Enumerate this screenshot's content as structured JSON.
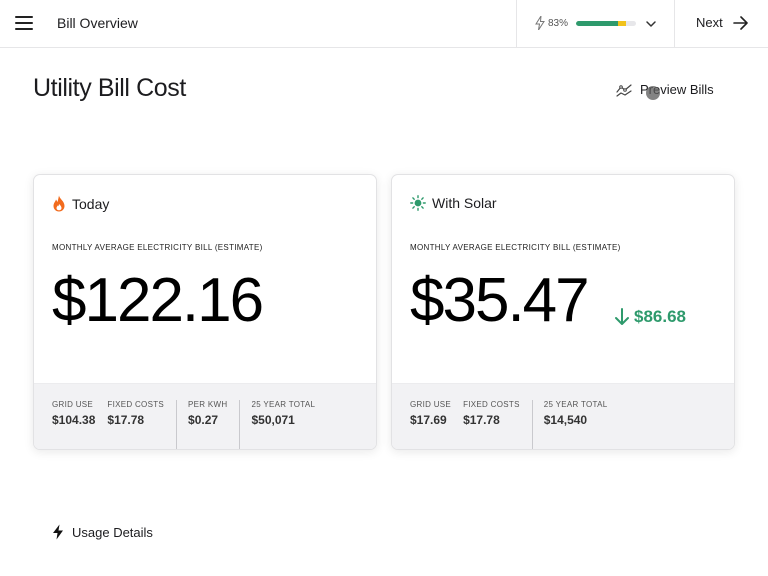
{
  "header": {
    "title": "Bill Overview",
    "progress_text": "83%",
    "progress_value": 0.83,
    "next_label": "Next"
  },
  "page": {
    "title": "Utility Bill Cost",
    "preview_label": "Preview Bills"
  },
  "cards": {
    "today": {
      "title": "Today",
      "subtitle": "MONTHLY AVERAGE ELECTRICITY BILL (ESTIMATE)",
      "amount": "$122.16",
      "stats": [
        {
          "label": "GRID USE",
          "value": "$104.38"
        },
        {
          "label": "FIXED COSTS",
          "value": "$17.78"
        },
        {
          "label": "PER KWH",
          "value": "$0.27"
        },
        {
          "label": "25 YEAR TOTAL",
          "value": "$50,071"
        }
      ]
    },
    "solar": {
      "title": "With Solar",
      "subtitle": "MONTHLY AVERAGE ELECTRICITY BILL (ESTIMATE)",
      "amount": "$35.47",
      "savings": "$86.68",
      "stats": [
        {
          "label": "GRID USE",
          "value": "$17.69"
        },
        {
          "label": "FIXED COSTS",
          "value": "$17.78"
        },
        {
          "label": "25 YEAR TOTAL",
          "value": "$14,540"
        }
      ]
    }
  },
  "usage": {
    "label": "Usage Details"
  },
  "colors": {
    "accent_green": "#2e9a6c",
    "flame_orange": "#f26b1d",
    "warning_yellow": "#f1c21b"
  },
  "icons": [
    "menu-icon",
    "bolt-icon",
    "chevron-down-icon",
    "arrow-right-icon",
    "chart-icon",
    "flame-icon",
    "sun-icon",
    "arrow-down-icon"
  ]
}
